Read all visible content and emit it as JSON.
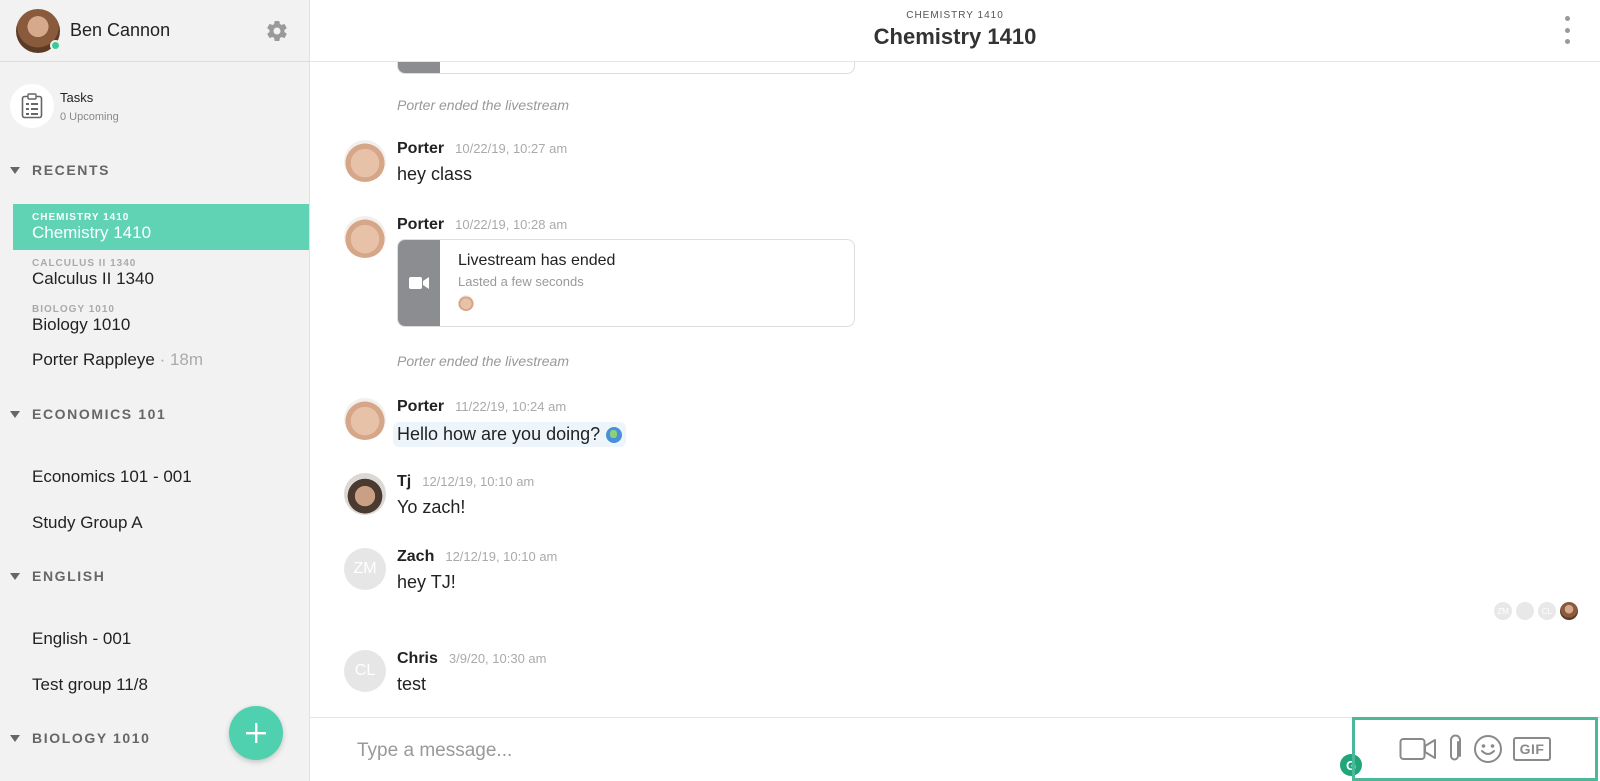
{
  "user": {
    "name": "Ben Cannon"
  },
  "tasks": {
    "title": "Tasks",
    "subtitle": "0 Upcoming"
  },
  "sections": [
    {
      "title": "RECENTS"
    },
    {
      "title": "ECONOMICS 101"
    },
    {
      "title": "ENGLISH"
    },
    {
      "title": "BIOLOGY 1010"
    }
  ],
  "recents": [
    {
      "kicker": "CHEMISTRY 1410",
      "label": "Chemistry 1410"
    },
    {
      "kicker": "CALCULUS II 1340",
      "label": "Calculus II 1340"
    },
    {
      "kicker": "BIOLOGY 1010",
      "label": "Biology 1010"
    },
    {
      "label": "Porter Rappleye",
      "meta": "· 18m"
    }
  ],
  "economics": [
    {
      "label": "Economics 101 - 001"
    },
    {
      "label": "Study Group A"
    }
  ],
  "english": [
    {
      "label": "English - 001"
    },
    {
      "label": "Test group 11/8"
    }
  ],
  "header": {
    "kicker": "CHEMISTRY 1410",
    "title": "Chemistry 1410"
  },
  "notes": {
    "ended": "Porter ended the livestream"
  },
  "messages": [
    {
      "who": "Porter",
      "ts": "10/22/19, 10:27 am",
      "text": "hey class"
    },
    {
      "who": "Porter",
      "ts": "10/22/19, 10:28 am",
      "card_title": "Livestream has ended",
      "card_sub": "Lasted a few seconds"
    },
    {
      "who": "Porter",
      "ts": "11/22/19, 10:24 am",
      "text": "Hello how are you doing?"
    },
    {
      "who": "Tj",
      "ts": "12/12/19, 10:10 am",
      "text": "Yo zach!"
    },
    {
      "who": "Zach",
      "initials": "ZM",
      "ts": "12/12/19, 10:10 am",
      "text": "hey TJ!"
    },
    {
      "who": "Chris",
      "initials": "CL",
      "ts": "3/9/20, 10:30 am",
      "text": "test"
    }
  ],
  "readers": [
    "ZM",
    "CL"
  ],
  "composer": {
    "placeholder": "Type a message...",
    "gif_label": "GIF",
    "grammarly": "G"
  },
  "colors": {
    "accent": "#5fd3b3",
    "fab": "#4fd0ae",
    "toolbar_border": "#4bb89a"
  }
}
